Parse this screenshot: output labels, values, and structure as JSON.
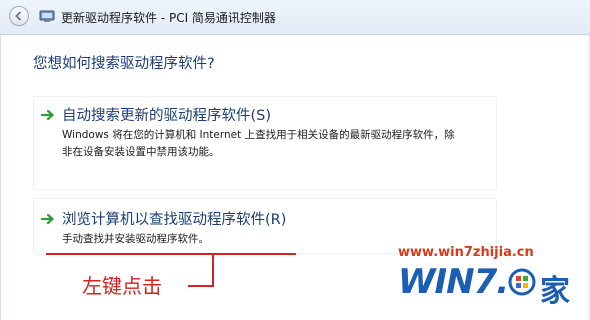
{
  "window": {
    "title": "更新驱动程序软件 - PCI 简易通讯控制器"
  },
  "main": {
    "heading": "您想如何搜索驱动程序软件?",
    "options": [
      {
        "title": "自动搜索更新的驱动程序软件(S)",
        "desc_line1": "Windows 将在您的计算机和 Internet 上查找用于相关设备的最新驱动程序软件，除",
        "desc_line2": "非在设备安装设置中禁用该功能。"
      },
      {
        "title": "浏览计算机以查找驱动程序软件(R)",
        "desc_line1": "手动查找并安装驱动程序软件。"
      }
    ]
  },
  "annotation": {
    "text": "左键点击",
    "color": "#d72020"
  },
  "watermark": {
    "url": "www.win7zhijia.cn",
    "logo": "WIN7.",
    "logo_char": "家"
  },
  "colors": {
    "heading": "#1b3e78",
    "arrow": "#2e9e3a",
    "title_bar": "#e6eef8"
  },
  "icons": {
    "back": "back-arrow-icon",
    "title": "device-manager-icon",
    "option_arrow": "green-arrow-icon"
  }
}
